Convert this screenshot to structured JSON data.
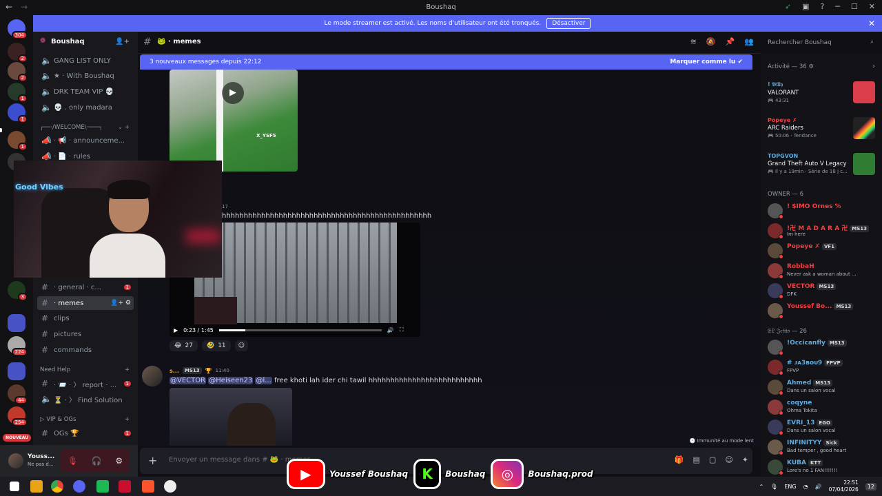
{
  "window": {
    "title": "Boushaq"
  },
  "banner": {
    "text": "Le mode streamer est activé. Les noms d'utilisateur ont été tronqués.",
    "button": "Désactiver"
  },
  "rail": {
    "badges": [
      "304",
      "2",
      "2",
      "1",
      "1",
      "1",
      "1",
      "1",
      "3",
      "224",
      "44",
      "254"
    ],
    "new_label": "NOUVEAU"
  },
  "server": {
    "name": "Boushaq"
  },
  "sidebar": {
    "voice_channels": [
      {
        "label": "GANG LIST ONLY"
      },
      {
        "label": "★ · With Boushaq"
      },
      {
        "label": "DRK TEAM VIP 💀"
      },
      {
        "label": "💀 . only madara"
      }
    ],
    "welcome_category": "┌──·/WELCOME\\·───┐",
    "channels": [
      {
        "label": "· 📢 · announceme..."
      },
      {
        "label": "· 📄 · rules"
      },
      {
        "label": "· general · c...",
        "badge": "1"
      },
      {
        "label": "· memes"
      },
      {
        "label": "clips"
      },
      {
        "label": "pictures"
      },
      {
        "label": "commands"
      }
    ],
    "help_category": "Need Help",
    "help_channels": [
      {
        "label": "· 📨 · 〉 report · ...",
        "badge": "1"
      },
      {
        "label": "⏳ · 〉 Find Solution"
      }
    ],
    "vip_category": "▷ VIP & OGs",
    "vip_channels": [
      {
        "label": "OGs 🏆",
        "badge": "1"
      }
    ]
  },
  "user": {
    "name": "Youss...",
    "status": "Ne pas d..."
  },
  "header": {
    "channel": "memes"
  },
  "search": {
    "placeholder": "Rechercher Boushaq"
  },
  "newbar": {
    "left": "3 nouveaux messages depuis 22:12",
    "right": "Marquer comme lu"
  },
  "chat": {
    "media1_watermark": "X_YSF5",
    "ts17": "17",
    "msg_text": "hhhhhhhhhhhhhhhhhhhhhhhhhhhhhhhhhhhhhhhhhhhhhhhh",
    "video_time": "0:23 / 1:45",
    "video_progress": 0.16,
    "reactions": [
      {
        "emoji": "😂",
        "count": "27"
      },
      {
        "emoji": "🤣",
        "count": "11"
      }
    ],
    "msg2": {
      "author": "s...",
      "tag": "MS13",
      "time": "11:40",
      "mention1": "@VECTOR",
      "mention2": "@Heiseen23",
      "mention3": "@l...",
      "text": "free khoti lah ider chi tawil hhhhhhhhhhhhhhhhhhhhhhhhhh"
    },
    "slowmode": "Immunité au mode lent"
  },
  "composer": {
    "placeholder": "Envoyer un message dans # 🐸 · memes"
  },
  "members": {
    "activity_header": "Activité — 36",
    "activities": [
      {
        "user": "! 𝔅𝔦𝔩𝔩𝔶",
        "game": "VALORANT",
        "time": "43:31",
        "color": "#5dade2",
        "art": "#ff4655"
      },
      {
        "user": "Popeye ✗",
        "game": "ARC Raiders",
        "time": "50:06 · Tendance",
        "color": "#f23f43",
        "art": "#222"
      },
      {
        "user": "TOPGVON",
        "game": "Grand Theft Auto V Legacy",
        "time": "Il y a 19min · Série de 18 j c...",
        "color": "#5dade2",
        "art": "#2e7d32"
      }
    ],
    "owner_header": "OWNER — 6",
    "owners": [
      {
        "name": "! $IMO Ornes %",
        "status": "",
        "tag": "",
        "color": "#f23f43"
      },
      {
        "name": "!卍 M A D A R A 卍",
        "status": "Im here",
        "tag": "MS13",
        "color": "#f23f43"
      },
      {
        "name": "Popeye ✗",
        "status": "",
        "tag": "VF1",
        "color": "#f23f43"
      },
      {
        "name": "RobbaH",
        "status": "Never ask a woman about ...",
        "tag": "",
        "color": "#f23f43"
      },
      {
        "name": "VECTOR",
        "status": "DFK",
        "tag": "MS13",
        "color": "#f23f43"
      },
      {
        "name": "Youssef Bo...",
        "status": "",
        "tag": "MS13",
        "color": "#f23f43"
      }
    ],
    "group2_header": "𝔈𝔏 𝔍𝔢𝔣𝔦𝔱𝔬 — 26",
    "group2": [
      {
        "name": "!Occicanfly",
        "status": "",
        "tag": "MS13",
        "color": "#5dade2"
      },
      {
        "name": "# ᴊᴀ3ʙᴏᴜ9",
        "status": "FPVP",
        "tag": "FPVP",
        "color": "#5dade2"
      },
      {
        "name": "Ahmed",
        "status": "Dans un salon vocal",
        "tag": "MS13",
        "color": "#5dade2"
      },
      {
        "name": "coqyne",
        "status": "Ohma Tokita",
        "tag": "",
        "color": "#5dade2"
      },
      {
        "name": "EVRI_13",
        "status": "Dans un salon vocal",
        "tag": "EGO",
        "color": "#5dade2"
      },
      {
        "name": "INFINITYY",
        "status": "Bad temper , good heart",
        "tag": "Sick",
        "color": "#5dade2"
      },
      {
        "name": "KUBA",
        "status": "Lore's no 1 FAN!!!!!!!",
        "tag": "KTT",
        "color": "#5dade2"
      }
    ]
  },
  "taskbar": {
    "lang": "ENG",
    "time": "22:51",
    "date": "07/04/2026",
    "notif": "12"
  },
  "overlay": {
    "cam_text": "Good Vibes",
    "youtube": "Youssef Boushaq",
    "kick": "Boushaq",
    "instagram": "Boushaq.prod"
  },
  "colors": {
    "accent": "#5865f2",
    "danger": "#da373c"
  }
}
